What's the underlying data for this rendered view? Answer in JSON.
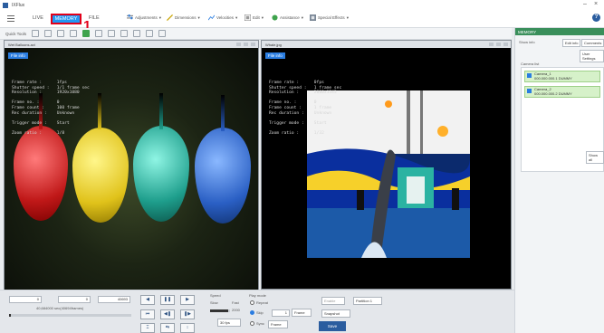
{
  "app": {
    "title": "IXFlux",
    "help_icon": "help-icon"
  },
  "menubar": {
    "tabs": [
      {
        "label": "LIVE"
      },
      {
        "label": "MEMORY"
      },
      {
        "label": "FILE"
      }
    ],
    "callout": "1",
    "menus": [
      {
        "label": "Adjustments",
        "icon": "adjust-icon"
      },
      {
        "label": "Dimensions",
        "icon": "ruler-icon"
      },
      {
        "label": "Velocities",
        "icon": "chart-icon"
      },
      {
        "label": "Edit",
        "icon": "edit-icon"
      },
      {
        "label": "Assistance",
        "icon": "globe-icon"
      },
      {
        "label": "Special Effects",
        "icon": "effects-icon"
      }
    ]
  },
  "quickbar": {
    "label": "Quick Tools"
  },
  "viewers": [
    {
      "title": "Wet Balloons.avi",
      "fileinfo": "File info",
      "overlay": "Frame rate :      1fps\nShutter speed :   1/1 frame sec\nResolution :      1920x1080\n\nFrame no. :       0\nFrame count :     100 frame\nRec duration :    Unknown\n\nTrigger mode :    Start\n\nZoom ratio :      1/8"
    },
    {
      "title": "Whale.jpg",
      "fileinfo": "File info",
      "overlay": "Frame rate :      0fps\nShutter speed :   1 frame sec\nResolution :      2000x1545\n\nFrame no. :       0\nFrame count :     1 frame\nRec duration :    Unknown\n\nTrigger mode :    Start\n\nZoom ratio :      1/32"
    }
  ],
  "rpanel": {
    "header": "MEMORY",
    "show_info": "Show info",
    "edit_info": "Edit info",
    "comments": "Comments",
    "user_settings": "User Settings",
    "camera_list_label": "Camera list",
    "cameras": [
      {
        "name": "Camera_1",
        "addr": "000.000.000.1  DUMMY"
      },
      {
        "name": "Camera_2",
        "addr": "000.000.000.2  DUMMY"
      }
    ],
    "show_all": "Show all"
  },
  "bottom": {
    "start_value": "0",
    "mid_value": "0",
    "end_value": "40693",
    "time_text": "40,684000 sec(40694frames)",
    "speed_label": "Speed",
    "slow": "Slow",
    "fast": "Fast",
    "speed_value": "2000",
    "fps_value": "30 fps",
    "play_mode_label": "Play mode",
    "repeat": "Repeat",
    "skip": "Skip",
    "sync": "Sync",
    "skip_value": "1",
    "skip_unit": "Frame",
    "sync_unit": "Frame",
    "enable": "Enable",
    "partition": "Partition 1",
    "snapshot": "Snapshot",
    "save": "Save"
  },
  "colors": {
    "accent": "#2196f3",
    "highlight_border": "#e2001a",
    "panel_header": "#3a8f5b",
    "camera_bg": "#d6f1c9"
  }
}
